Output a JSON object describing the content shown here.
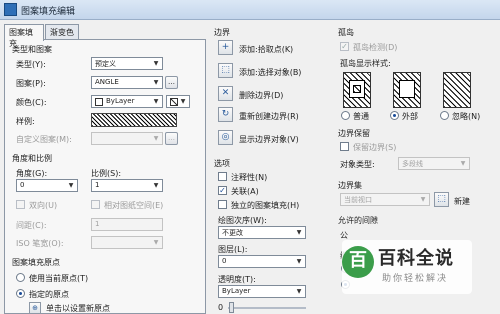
{
  "window": {
    "title": "图案填充编辑"
  },
  "tabs": [
    {
      "label": "图案填充"
    },
    {
      "label": "渐变色"
    }
  ],
  "type_pattern": {
    "group": "类型和图案",
    "type_label": "类型(Y):",
    "type_value": "预定义",
    "pattern_label": "图案(P):",
    "pattern_value": "ANGLE",
    "color_label": "颜色(C):",
    "color_value": "ByLayer",
    "swatch_label": "样例:",
    "custom_label": "自定义图案(M):"
  },
  "angle_scale": {
    "group": "角度和比例",
    "angle_label": "角度(G):",
    "angle_value": "0",
    "scale_label": "比例(S):",
    "scale_value": "1",
    "double_label": "双向(U)",
    "relative_label": "相对图纸空间(E)",
    "spacing_label": "间距(C):",
    "spacing_value": "1",
    "iso_label": "ISO 笔宽(O):"
  },
  "origin": {
    "group": "图案填充原点",
    "use_current": "使用当前原点(T)",
    "specified": "指定的原点",
    "click_set": "单击以设置新原点"
  },
  "boundary": {
    "group": "边界",
    "items": [
      {
        "label": "添加:拾取点(K)",
        "icon": "plus-pick-icon"
      },
      {
        "label": "添加:选择对象(B)",
        "icon": "select-objects-icon"
      },
      {
        "label": "删除边界(D)",
        "icon": "remove-boundary-icon"
      },
      {
        "label": "重新创建边界(R)",
        "icon": "recreate-boundary-icon"
      },
      {
        "label": "显示边界对象(V)",
        "icon": "view-selections-icon"
      }
    ]
  },
  "options": {
    "group": "选项",
    "annotative": "注释性(N)",
    "associative": "关联(A)",
    "separate": "独立的图案填充(H)",
    "draw_order_label": "绘图次序(W):",
    "draw_order_value": "不更改",
    "layer_label": "图层(L):",
    "layer_value": "0",
    "transparency_label": "透明度(T):",
    "transparency_value": "ByLayer",
    "transparency_number": "0"
  },
  "islands": {
    "group": "孤岛",
    "detection": "孤岛检测(D)",
    "style_label": "孤岛显示样式:",
    "styles": [
      "普通",
      "外部",
      "忽略(N)"
    ]
  },
  "retain": {
    "group": "边界保留",
    "retain_label": "保留边界(S)",
    "object_type_label": "对象类型:",
    "object_type_value": "多段线"
  },
  "boundary_set": {
    "group": "边界集",
    "value": "当前视口",
    "new_label": "新建"
  },
  "gap": {
    "group": "允许的间隙",
    "tolerance_label": "公",
    "inherit_label": "继"
  },
  "watermark": {
    "logo": "百",
    "main": "百科全说",
    "sub": "助你轻松解决"
  }
}
